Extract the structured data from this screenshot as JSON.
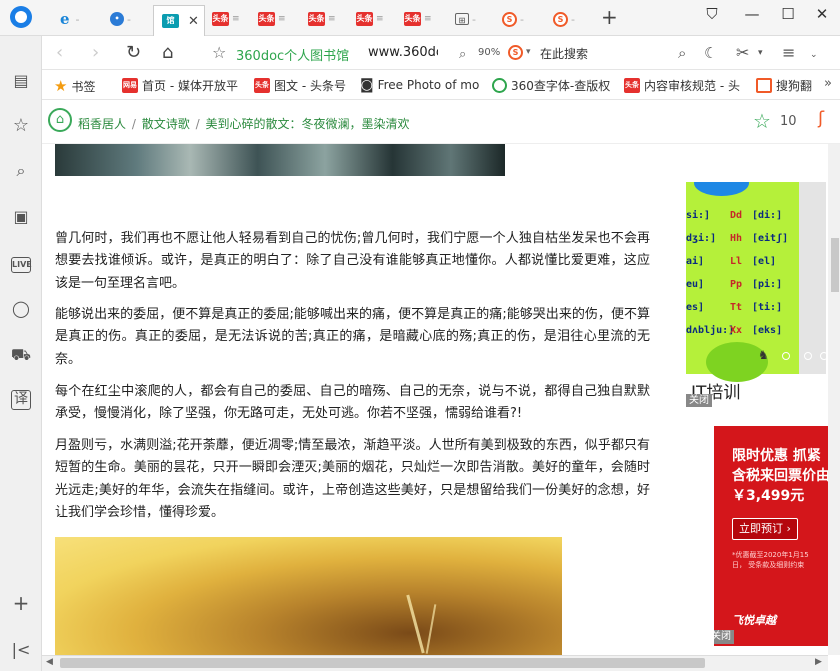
{
  "tabs": [
    {
      "label": "",
      "icon": "ie-icon",
      "kind": "ie"
    },
    {
      "label": "",
      "icon": "baidu-paw-icon",
      "kind": "baidu"
    },
    {
      "label": "",
      "icon": "360doc-icon",
      "kind": "active",
      "favicon_text": "馆"
    },
    {
      "label": "",
      "icon": "toutiao-icon",
      "favicon_text": "头条"
    },
    {
      "label": "",
      "icon": "toutiao-icon",
      "favicon_text": "头条"
    },
    {
      "label": "",
      "icon": "toutiao-icon",
      "favicon_text": "头条"
    },
    {
      "label": "",
      "icon": "toutiao-icon",
      "favicon_text": "头条"
    },
    {
      "label": "",
      "icon": "toutiao-icon",
      "favicon_text": "头条"
    },
    {
      "label": "",
      "icon": "grid-icon",
      "favicon_text": ""
    },
    {
      "label": "",
      "icon": "sogou-icon",
      "favicon_text": "S"
    },
    {
      "label": "",
      "icon": "sogou-icon",
      "favicon_text": "S"
    }
  ],
  "toolbar": {
    "site_name": "360doc个人图书馆",
    "url": "www.360doc",
    "zoom": "90%",
    "search_placeholder": "在此搜索"
  },
  "bookmarks": [
    {
      "label": "书签",
      "icon": "star-icon"
    },
    {
      "label": "首页 - 媒体开放平",
      "icon": "netease-icon",
      "favicon_text": "网易"
    },
    {
      "label": "图文 - 头条号",
      "icon": "toutiao-icon",
      "favicon_text": "头条"
    },
    {
      "label": "Free Photo of mo",
      "icon": "camera-icon"
    },
    {
      "label": "360查字体-查版权",
      "icon": "360-icon"
    },
    {
      "label": "内容审核规范 - 头",
      "icon": "toutiao-icon",
      "favicon_text": "头条"
    },
    {
      "label": "搜狗翻",
      "icon": "sogou-icon",
      "favicon_text": "S"
    }
  ],
  "breadcrumb": {
    "items": [
      "稻香居人",
      "散文诗歌",
      "美到心碎的散文：冬夜微澜，墨染清欢"
    ],
    "separator": "/"
  },
  "favorite_count": "10",
  "article": {
    "paragraphs": [
      "曾几何时，我们再也不愿让他人轻易看到自己的忧伤;曾几何时，我们宁愿一个人独自枯坐发呆也不会再想要去找谁倾诉。或许，是真正的明白了：除了自己没有谁能够真正地懂你。人都说懂比爱更难，这应该是一句至理名言吧。",
      "能够说出来的委屈，便不算是真正的委屈;能够喊出来的痛，便不算是真正的痛;能够哭出来的伤，便不算是真正的伤。真正的委屈，是无法诉说的苦;真正的痛，是暗藏心底的殇;真正的伤，是泪往心里流的无奈。",
      "每个在红尘中滚爬的人，都会有自己的委屈、自己的暗殇、自己的无奈，说与不说，都得自己独自默默承受，慢慢消化，除了坚强，你无路可走，无处可逃。你若不坚强，懦弱给谁看?!",
      "月盈则亏，水满则溢;花开荼蘼，便近凋零;情至最浓，渐趋平淡。人世所有美到极致的东西，似乎都只有短暂的生命。美丽的昙花，只开一瞬即会湮灭;美丽的烟花，只灿烂一次即告消散。美好的童年，会随时光远走;美好的年华，会流失在指缝间。或许，上帝创造这些美好，只是想留给我们一份美好的念想，好让我们学会珍惜，懂得珍爱。"
    ]
  },
  "ads": {
    "ad1": {
      "title": "IT培训",
      "close_label": "关闭",
      "phonetics": [
        [
          "si:]",
          "Dd",
          "[di:]"
        ],
        [
          "dʒi:]",
          "Hh",
          "[eitʃ]"
        ],
        [
          "ai]",
          "Ll",
          "[el]"
        ],
        [
          "eu]",
          "Pp",
          "[pi:]"
        ],
        [
          "es]",
          "Tt",
          "[ti:]"
        ],
        [
          "dʌblju:]",
          "Xx",
          "[eks]"
        ]
      ]
    },
    "ad2": {
      "title": "限时优惠 抓紧含税来回票价由￥3,499元",
      "button": "立即预订 ›",
      "note": "*优惠截至2020年1月15日，\n受条款及细则约束",
      "brand": "飞悦卓越",
      "close_label": "关闭"
    }
  },
  "colors": {
    "accent_green": "#2ea54d",
    "ad_red": "#d4161b",
    "ad_lime": "#b5f03a"
  }
}
